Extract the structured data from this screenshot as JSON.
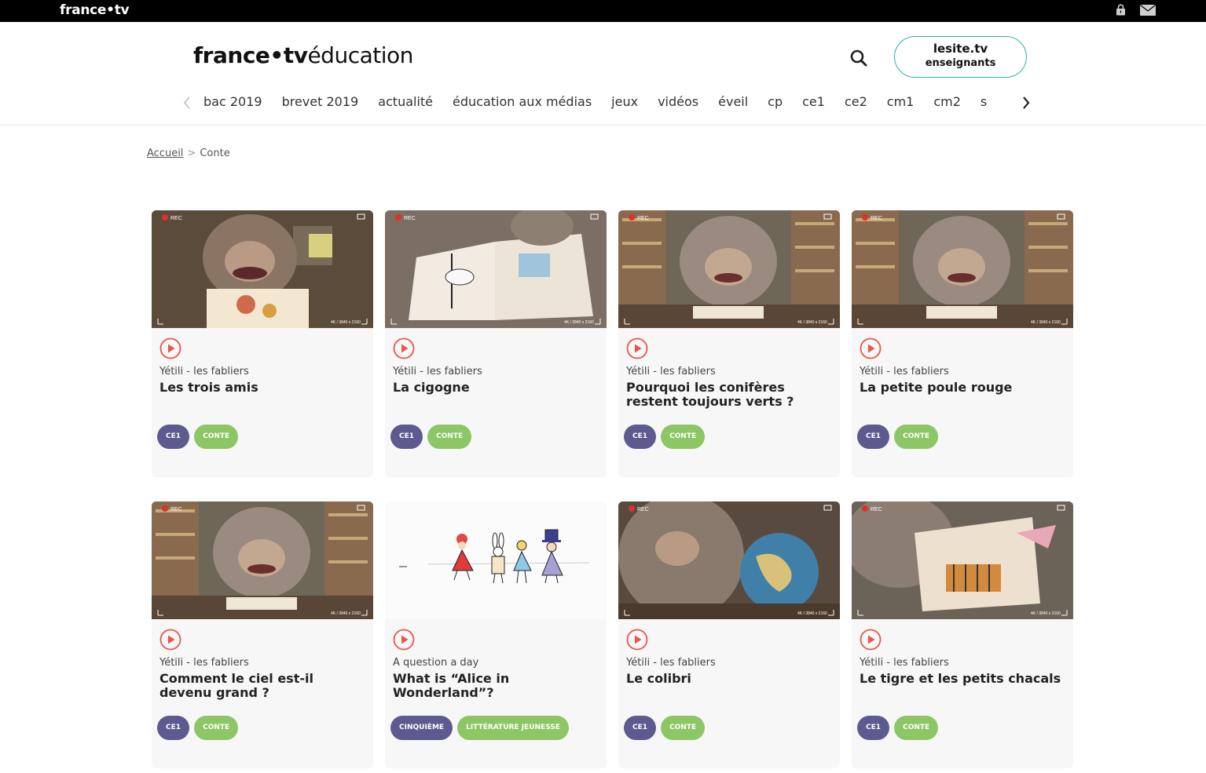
{
  "topbar": {
    "brand": "france•tv",
    "lock_icon": "lock-icon",
    "mail_icon": "mail-icon"
  },
  "header": {
    "logo_brand": "france•tv",
    "logo_suffix": "éducation",
    "search_icon": "search-icon",
    "teacher_button": {
      "line1": "lesite.tv",
      "line2": "enseignants",
      "border_color": "#2bb3a3"
    }
  },
  "nav": {
    "items": [
      "bac 2019",
      "brevet 2019",
      "actualité",
      "éducation aux médias",
      "jeux",
      "vidéos",
      "éveil",
      "cp",
      "ce1",
      "ce2",
      "cm1",
      "cm2",
      "s"
    ]
  },
  "breadcrumb": {
    "home": "Accueil",
    "separator": ">",
    "current": "Conte"
  },
  "colors": {
    "play": "#e8554a",
    "level_tag": "#5c5a8e",
    "subject_tag": "#8cc665",
    "teal": "#2bb3a3"
  },
  "cards": [
    {
      "program": "Yétili - les fabliers",
      "title": "Les trois amis",
      "level": "CE1",
      "subject": "CONTE",
      "thumb": "yetili-book"
    },
    {
      "program": "Yétili - les fabliers",
      "title": "La cigogne",
      "level": "CE1",
      "subject": "CONTE",
      "thumb": "stork-book"
    },
    {
      "program": "Yétili - les fabliers",
      "title": "Pourquoi les conifères restent toujours verts ?",
      "level": "CE1",
      "subject": "CONTE",
      "thumb": "yetili-library"
    },
    {
      "program": "Yétili - les fabliers",
      "title": "La petite poule rouge",
      "level": "CE1",
      "subject": "CONTE",
      "thumb": "yetili-library"
    },
    {
      "program": "Yétili - les fabliers",
      "title": "Comment le ciel est-il devenu grand ?",
      "level": "CE1",
      "subject": "CONTE",
      "thumb": "yetili-wave"
    },
    {
      "program": "A question a day",
      "title": "What is “Alice in Wonderland”?",
      "level": "CINQUIÈME",
      "subject": "LITTÉRATURE JEUNESSE",
      "thumb": "alice-drawing"
    },
    {
      "program": "Yétili - les fabliers",
      "title": "Le colibri",
      "level": "CE1",
      "subject": "CONTE",
      "thumb": "yetili-globe"
    },
    {
      "program": "Yétili - les fabliers",
      "title": "Le tigre et les petits chacals",
      "level": "CE1",
      "subject": "CONTE",
      "thumb": "tiger-book"
    }
  ]
}
